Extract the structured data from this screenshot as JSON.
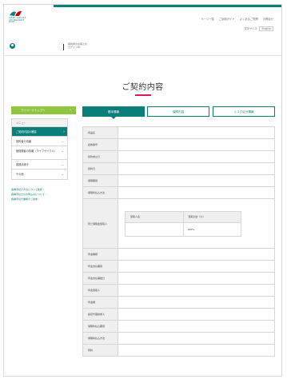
{
  "header": {
    "logo_lines": [
      "CREDIT AGRICOLE",
      "LIFE INSURANCE",
      "JAPAN"
    ],
    "links": [
      "ページ一覧",
      "ご利用ガイド",
      "よくあるご質問",
      "お問合せ"
    ],
    "sub_text": "文字サイズ",
    "lang_button": "English"
  },
  "user_bar": {
    "line1": "契約者のお客さま",
    "line2": "ログイン中"
  },
  "page": {
    "title": "ご契約内容"
  },
  "sidebar": {
    "top_button": "マイページトップへ",
    "menu": [
      {
        "label": "メニュー",
        "kind": "head"
      },
      {
        "label": "ご契約内容の確認",
        "kind": "active"
      },
      {
        "label": "契約者の情報",
        "kind": "chev"
      },
      {
        "label": "被保険者の情報（ライフサイクル）",
        "kind": "chev-tall"
      },
      {
        "label": "各種手続き",
        "kind": "chev"
      },
      {
        "label": "その他",
        "kind": "chev"
      }
    ],
    "links": [
      "各種手続き方法について確認 ›",
      "各種手続きのお申込みについて ›",
      "各種手続き書類のご請求 ›"
    ]
  },
  "tabs": [
    {
      "label": "基本情報",
      "active": true
    },
    {
      "label": "保障内容",
      "active": false
    },
    {
      "label": "リスク区分情報",
      "active": false
    }
  ],
  "table": {
    "rows_top": [
      "商品名",
      "証券番号",
      "契約成立日",
      "契約日",
      "保険期間",
      "保険料払込方法"
    ],
    "beneficiary_label": "死亡保険金受取人",
    "inner_headers": [
      "受取人名",
      "受取割合（％）"
    ],
    "inner_row": [
      "",
      "100%"
    ],
    "rows_bottom": [
      "年金種類",
      "年金支払期間",
      "年金支払開始日",
      "年金受取人",
      "年金額",
      "指定代理請求人",
      "保険料払込期間",
      "保険料払込方法",
      "特約"
    ]
  }
}
